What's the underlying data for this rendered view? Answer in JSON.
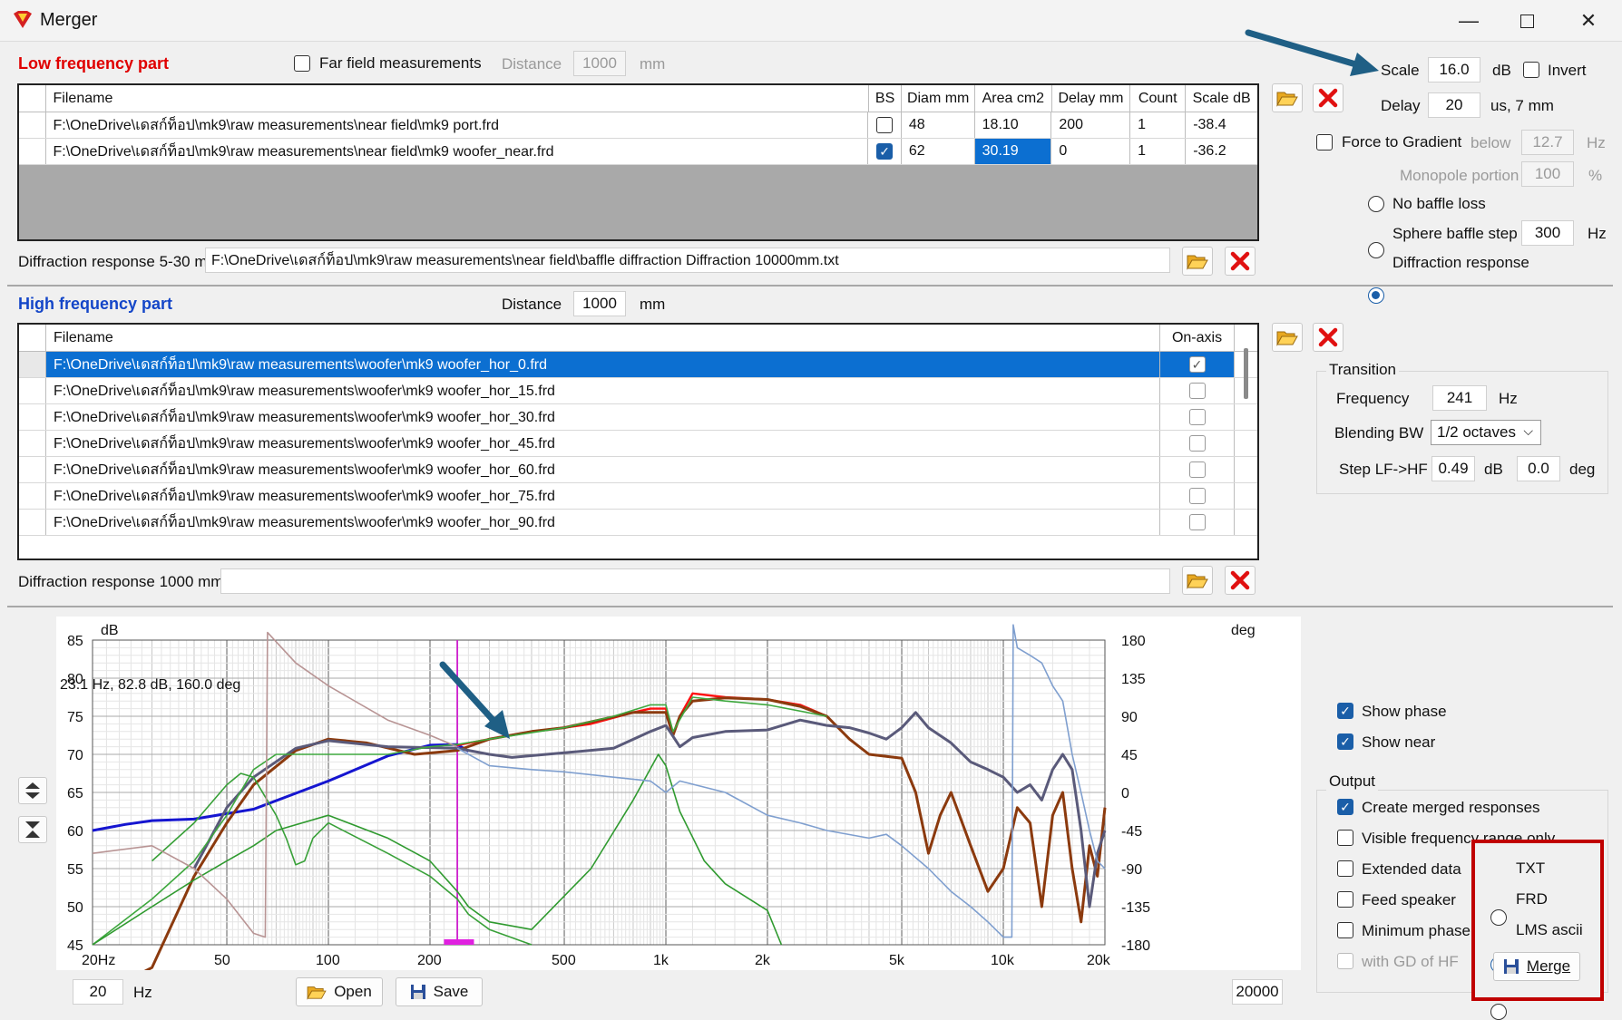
{
  "window": {
    "title": "Merger"
  },
  "lf": {
    "title": "Low frequency part",
    "far_field_label": "Far field measurements",
    "distance_label": "Distance",
    "distance_value": "1000",
    "distance_unit": "mm",
    "headers": [
      "Filename",
      "BS",
      "Diam mm",
      "Area cm2",
      "Delay mm",
      "Count",
      "Scale dB"
    ],
    "rows": [
      {
        "filename": "F:\\OneDrive\\เดสก์ท็อป\\mk9\\raw measurements\\near field\\mk9 port.frd",
        "diam": "48",
        "area": "18.10",
        "delay": "200",
        "count": "1",
        "scale": "-38.4"
      },
      {
        "filename": "F:\\OneDrive\\เดสก์ท็อป\\mk9\\raw measurements\\near field\\mk9 woofer_near.frd",
        "diam": "62",
        "area": "30.19",
        "delay": "0",
        "count": "1",
        "scale": "-36.2"
      }
    ],
    "diffraction_label": "Diffraction response 5-30 m",
    "diffraction_path": "F:\\OneDrive\\เดสก์ท็อป\\mk9\\raw measurements\\near field\\baffle diffraction Diffraction 10000mm.txt"
  },
  "right_top": {
    "scale_label": "Scale",
    "scale_value": "16.0",
    "scale_unit": "dB",
    "invert_label": "Invert",
    "delay_label": "Delay",
    "delay_value": "20",
    "delay_unit": "us, 7 mm",
    "force_label": "Force to Gradient",
    "below_label": "below",
    "below_value": "12.7",
    "below_unit": "Hz",
    "monopole_label": "Monopole portion",
    "monopole_value": "100",
    "monopole_unit": "%",
    "no_baffle_label": "No baffle loss",
    "sphere_label": "Sphere baffle step",
    "sphere_value": "300",
    "sphere_unit": "Hz",
    "diffraction_label": "Diffraction response"
  },
  "hf": {
    "title": "High frequency part",
    "distance_label": "Distance",
    "distance_value": "1000",
    "distance_unit": "mm",
    "headers": [
      "Filename",
      "On-axis"
    ],
    "rows": [
      "F:\\OneDrive\\เดสก์ท็อป\\mk9\\raw measurements\\woofer\\mk9 woofer_hor_0.frd",
      "F:\\OneDrive\\เดสก์ท็อป\\mk9\\raw measurements\\woofer\\mk9 woofer_hor_15.frd",
      "F:\\OneDrive\\เดสก์ท็อป\\mk9\\raw measurements\\woofer\\mk9 woofer_hor_30.frd",
      "F:\\OneDrive\\เดสก์ท็อป\\mk9\\raw measurements\\woofer\\mk9 woofer_hor_45.frd",
      "F:\\OneDrive\\เดสก์ท็อป\\mk9\\raw measurements\\woofer\\mk9 woofer_hor_60.frd",
      "F:\\OneDrive\\เดสก์ท็อป\\mk9\\raw measurements\\woofer\\mk9 woofer_hor_75.frd",
      "F:\\OneDrive\\เดสก์ท็อป\\mk9\\raw measurements\\woofer\\mk9 woofer_hor_90.frd"
    ],
    "diffraction_label": "Diffraction response 1000 mm",
    "diffraction_path": ""
  },
  "transition": {
    "title": "Transition",
    "freq_label": "Frequency",
    "freq_value": "241",
    "freq_unit": "Hz",
    "blend_label": "Blending BW",
    "blend_value": "1/2 octaves",
    "step_label": "Step LF->HF",
    "step_db": "0.49",
    "step_db_unit": "dB",
    "step_deg": "0.0",
    "step_deg_unit": "deg"
  },
  "plot": {
    "readout": "23.1 Hz, 82.8 dB, 160.0 deg",
    "y_unit_left": "dB",
    "y_unit_right": "deg",
    "y_left_ticks": [
      "85",
      "80",
      "75",
      "70",
      "65",
      "60",
      "55",
      "50",
      "45"
    ],
    "y_right_ticks": [
      "180",
      "135",
      "90",
      "45",
      "0",
      "-45",
      "-90",
      "-135",
      "-180"
    ],
    "x_ticks": [
      "20Hz",
      "50",
      "100",
      "200",
      "500",
      "1k",
      "2k",
      "5k",
      "10k",
      "20k"
    ],
    "xmin_value": "20",
    "xmin_unit": "Hz",
    "xmax_value": "20000",
    "open_label": "Open",
    "save_label": "Save"
  },
  "chart_data": {
    "type": "line",
    "x_scale": "log",
    "xlim": [
      20,
      20000
    ],
    "ylim": [
      45,
      85
    ],
    "ylim_right": [
      -180,
      180
    ],
    "grid": true,
    "marker_frequency": 241,
    "series": [
      {
        "color": "#1515d0",
        "points": [
          [
            20,
            60
          ],
          [
            25,
            60.8
          ],
          [
            30,
            61.3
          ],
          [
            40,
            61.5
          ],
          [
            60,
            62.8
          ],
          [
            100,
            66.5
          ],
          [
            150,
            69.8
          ],
          [
            200,
            71.2
          ],
          [
            241,
            71.3
          ],
          [
            260,
            70.4
          ]
        ]
      },
      {
        "color": "#ff1010",
        "points": [
          [
            241,
            71.2
          ],
          [
            300,
            72
          ],
          [
            400,
            73
          ],
          [
            500,
            73.5
          ],
          [
            600,
            74
          ],
          [
            800,
            75.5
          ],
          [
            900,
            76
          ],
          [
            1000,
            76
          ],
          [
            1050,
            72.5
          ],
          [
            1100,
            75
          ],
          [
            1200,
            78
          ],
          [
            1500,
            77.5
          ],
          [
            2000,
            77.2
          ],
          [
            2500,
            76.5
          ],
          [
            3000,
            75
          ],
          [
            3500,
            72
          ],
          [
            4000,
            70
          ],
          [
            5000,
            69.5
          ],
          [
            5500,
            65
          ],
          [
            6000,
            57
          ],
          [
            6500,
            62
          ],
          [
            7000,
            65
          ],
          [
            8000,
            58
          ],
          [
            9000,
            52
          ],
          [
            10000,
            55
          ],
          [
            11000,
            63
          ],
          [
            12000,
            61
          ],
          [
            13000,
            50
          ],
          [
            14000,
            62
          ],
          [
            15000,
            65
          ],
          [
            16000,
            55
          ],
          [
            17000,
            48
          ],
          [
            18000,
            58
          ],
          [
            19000,
            54
          ],
          [
            20000,
            63
          ]
        ]
      },
      {
        "color": "#8b3a0e",
        "points": [
          [
            20,
            38
          ],
          [
            30,
            42
          ],
          [
            40,
            54
          ],
          [
            50,
            61
          ],
          [
            60,
            66
          ],
          [
            80,
            70.5
          ],
          [
            100,
            72
          ],
          [
            130,
            71.5
          ],
          [
            180,
            70
          ],
          [
            241,
            70.5
          ],
          [
            300,
            72
          ],
          [
            400,
            73
          ],
          [
            500,
            73.5
          ],
          [
            800,
            75.5
          ],
          [
            1000,
            75.5
          ],
          [
            1050,
            72.5
          ],
          [
            1100,
            75
          ],
          [
            1200,
            77
          ],
          [
            1500,
            77.4
          ],
          [
            2000,
            77.2
          ],
          [
            2500,
            76.3
          ],
          [
            3000,
            75
          ],
          [
            3500,
            72
          ],
          [
            4000,
            70
          ],
          [
            5000,
            69.5
          ],
          [
            5500,
            65
          ],
          [
            6000,
            57
          ],
          [
            6500,
            62
          ],
          [
            7000,
            65
          ],
          [
            8000,
            58
          ],
          [
            9000,
            52
          ],
          [
            10000,
            55
          ],
          [
            11000,
            63
          ],
          [
            12000,
            61
          ],
          [
            13000,
            50
          ],
          [
            14000,
            62
          ],
          [
            15000,
            65
          ],
          [
            16000,
            55
          ],
          [
            17000,
            48
          ],
          [
            18000,
            58
          ],
          [
            19000,
            54
          ],
          [
            20000,
            63
          ]
        ]
      },
      {
        "color": "#5a5a7a",
        "points": [
          [
            40,
            55
          ],
          [
            50,
            63
          ],
          [
            60,
            67
          ],
          [
            80,
            70.8
          ],
          [
            100,
            71.8
          ],
          [
            150,
            71
          ],
          [
            241,
            70.8
          ],
          [
            300,
            70
          ],
          [
            350,
            69.6
          ],
          [
            500,
            70.2
          ],
          [
            700,
            70.8
          ],
          [
            900,
            73
          ],
          [
            1000,
            73.8
          ],
          [
            1100,
            71
          ],
          [
            1200,
            72.2
          ],
          [
            1500,
            73
          ],
          [
            2000,
            73.2
          ],
          [
            2500,
            74.5
          ],
          [
            3000,
            73.8
          ],
          [
            3500,
            73.5
          ],
          [
            4000,
            72.8
          ],
          [
            4500,
            72
          ],
          [
            5000,
            73.5
          ],
          [
            5500,
            75.5
          ],
          [
            6000,
            73.5
          ],
          [
            7000,
            71.5
          ],
          [
            8000,
            69
          ],
          [
            9000,
            68
          ],
          [
            10000,
            67
          ],
          [
            11000,
            65
          ],
          [
            12000,
            66
          ],
          [
            13000,
            64
          ],
          [
            14000,
            68
          ],
          [
            15000,
            70
          ],
          [
            16000,
            68
          ],
          [
            17000,
            60
          ],
          [
            18000,
            50
          ],
          [
            19000,
            57
          ],
          [
            20000,
            60
          ]
        ]
      },
      {
        "color": "#3ea83e",
        "points": [
          [
            20,
            45
          ],
          [
            30,
            51
          ],
          [
            40,
            56
          ],
          [
            50,
            62
          ],
          [
            60,
            68
          ],
          [
            70,
            70
          ],
          [
            100,
            70
          ],
          [
            150,
            70
          ],
          [
            200,
            71
          ],
          [
            241,
            71.3
          ],
          [
            300,
            72
          ],
          [
            500,
            73.5
          ],
          [
            700,
            75
          ],
          [
            900,
            76.5
          ],
          [
            1000,
            76.5
          ],
          [
            1050,
            73
          ],
          [
            1200,
            77.5
          ],
          [
            1500,
            77
          ],
          [
            2000,
            76.5
          ],
          [
            3000,
            75
          ]
        ]
      },
      {
        "color": "#2f9a2f",
        "points": [
          [
            20,
            45
          ],
          [
            30,
            50
          ],
          [
            40,
            53.5
          ],
          [
            50,
            56
          ],
          [
            60,
            58
          ],
          [
            70,
            60
          ],
          [
            100,
            62
          ],
          [
            150,
            59
          ],
          [
            200,
            56
          ],
          [
            241,
            52
          ],
          [
            260,
            50
          ],
          [
            300,
            48
          ],
          [
            400,
            47
          ],
          [
            600,
            55
          ],
          [
            800,
            64
          ],
          [
            950,
            70
          ],
          [
            1000,
            68.5
          ],
          [
            1100,
            62.5
          ],
          [
            1300,
            56
          ],
          [
            1500,
            53
          ],
          [
            2000,
            49.5
          ],
          [
            2200,
            45
          ]
        ]
      },
      {
        "color": "#38a038",
        "points": [
          [
            30,
            56
          ],
          [
            40,
            61
          ],
          [
            50,
            66
          ],
          [
            55,
            67.5
          ],
          [
            60,
            67
          ],
          [
            70,
            62
          ],
          [
            75,
            59
          ],
          [
            80,
            55.5
          ],
          [
            85,
            56
          ],
          [
            90,
            59
          ],
          [
            100,
            61
          ],
          [
            150,
            57
          ],
          [
            200,
            54
          ],
          [
            241,
            51
          ],
          [
            260,
            49
          ],
          [
            300,
            47
          ],
          [
            400,
            45
          ]
        ]
      },
      {
        "color": "#b89494",
        "points": [
          [
            20,
            57
          ],
          [
            30,
            58
          ],
          [
            40,
            55
          ],
          [
            50,
            51
          ],
          [
            60,
            46.5
          ],
          [
            65,
            46
          ],
          [
            66,
            86
          ],
          [
            80,
            82
          ],
          [
            100,
            79
          ],
          [
            150,
            74.5
          ],
          [
            200,
            72.5
          ],
          [
            241,
            71
          ]
        ]
      },
      {
        "color": "#7f9fcf",
        "points": [
          [
            241,
            70.8
          ],
          [
            300,
            68.5
          ],
          [
            400,
            68
          ],
          [
            500,
            67.7
          ],
          [
            700,
            67
          ],
          [
            900,
            66.5
          ],
          [
            1000,
            65
          ],
          [
            1100,
            66.5
          ],
          [
            1500,
            65
          ],
          [
            2000,
            62
          ],
          [
            2500,
            61
          ],
          [
            3000,
            60
          ],
          [
            4000,
            59
          ],
          [
            4500,
            59.5
          ],
          [
            5000,
            58
          ],
          [
            6000,
            55
          ],
          [
            7000,
            52
          ],
          [
            8000,
            50
          ],
          [
            9000,
            48
          ],
          [
            10000,
            46
          ],
          [
            10600,
            46
          ],
          [
            10700,
            87
          ],
          [
            11000,
            84
          ],
          [
            12000,
            83
          ],
          [
            13000,
            82
          ],
          [
            14000,
            79
          ],
          [
            15000,
            77
          ],
          [
            16000,
            70
          ],
          [
            17000,
            65
          ],
          [
            18000,
            60
          ],
          [
            19000,
            56
          ],
          [
            20000,
            55
          ]
        ]
      }
    ]
  },
  "options": {
    "show_phase": "Show phase",
    "show_near": "Show near",
    "output_title": "Output",
    "create_merged": "Create merged responses",
    "visible_only": "Visible frequency range only",
    "extended": "Extended data",
    "feed_speaker": "Feed speaker",
    "minimum_phase": "Minimum phase",
    "with_gd": "with GD of HF",
    "txt": "TXT",
    "frd": "FRD",
    "lms": "LMS ascii",
    "merge": "Merge"
  },
  "colors": {
    "lf_title": "#e00000",
    "hf_title": "#1446c8",
    "selection": "#0c6fd1",
    "arrow": "#1f5f85",
    "highlight_box": "#c00000"
  }
}
